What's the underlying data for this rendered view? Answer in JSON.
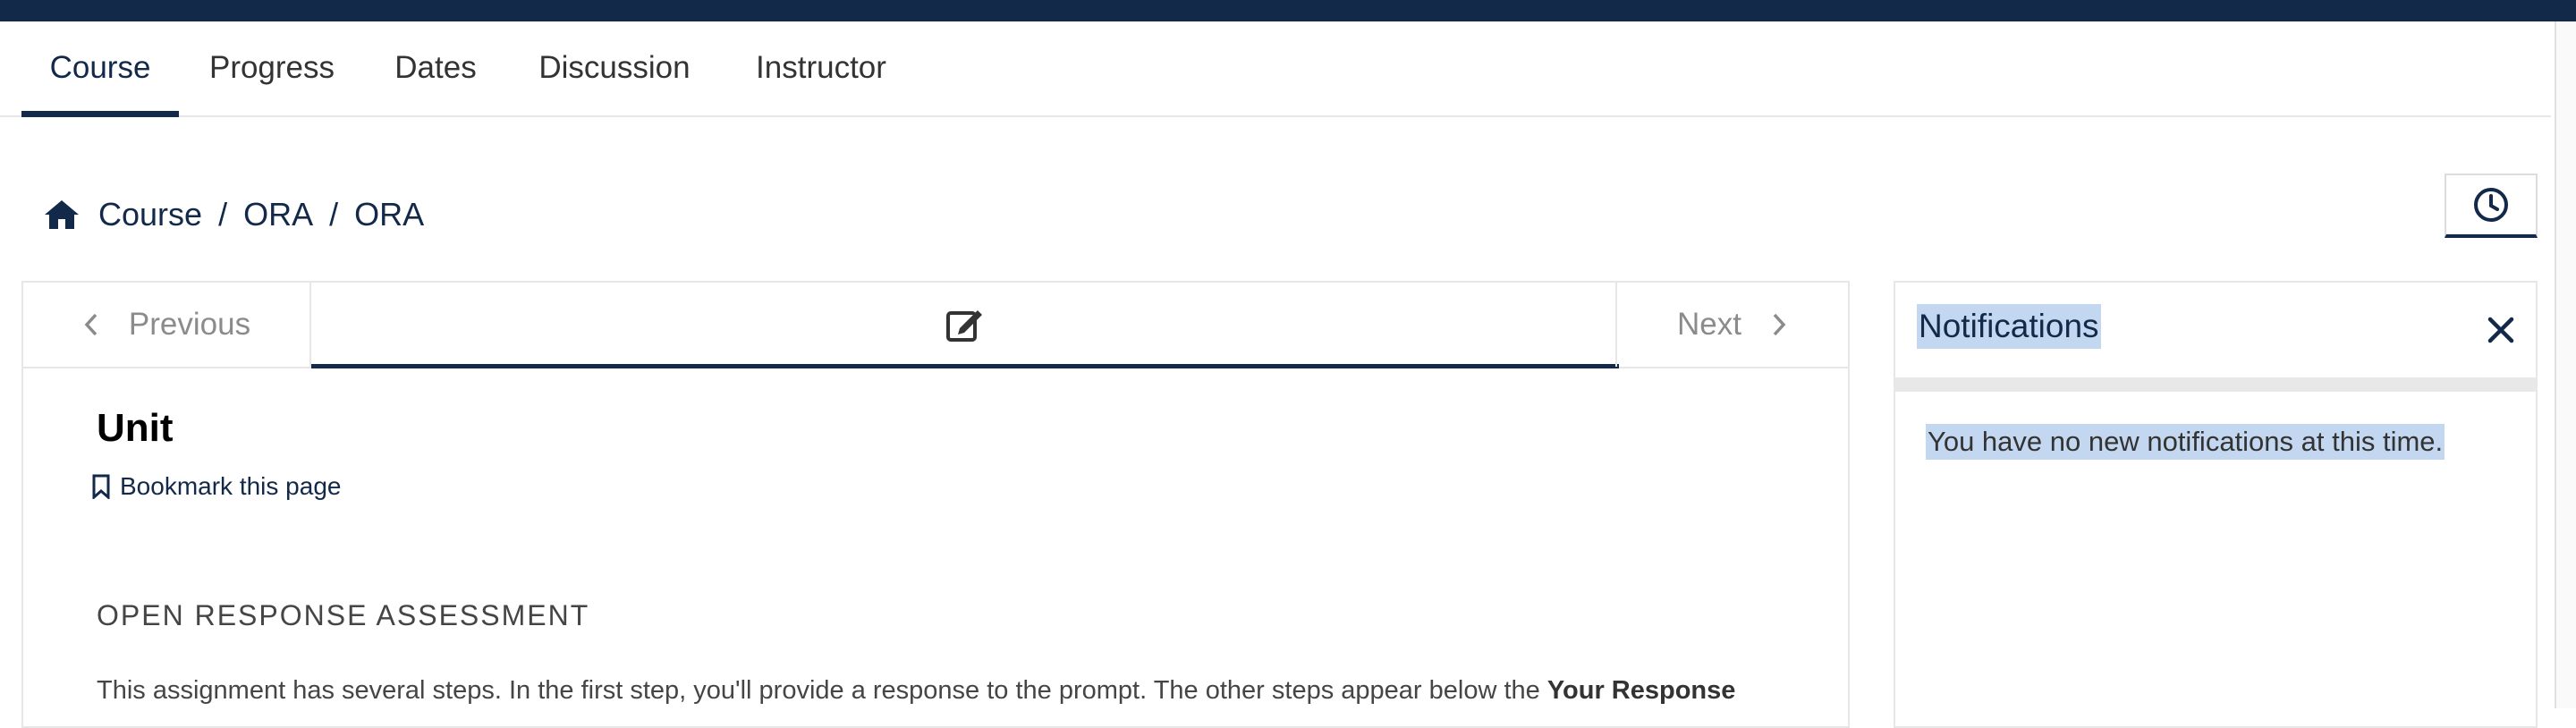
{
  "tabs": [
    {
      "label": "Course",
      "active": true
    },
    {
      "label": "Progress",
      "active": false
    },
    {
      "label": "Dates",
      "active": false
    },
    {
      "label": "Discussion",
      "active": false
    },
    {
      "label": "Instructor",
      "active": false
    }
  ],
  "breadcrumb": {
    "icon": "home-icon",
    "items": [
      "Course",
      "ORA",
      "ORA"
    ],
    "separator": "/"
  },
  "sequence_nav": {
    "previous_label": "Previous",
    "next_label": "Next",
    "unit_icon": "edit-icon"
  },
  "unit": {
    "title": "Unit",
    "bookmark_label": "Bookmark this page",
    "ora_heading": "OPEN RESPONSE ASSESSMENT",
    "ora_text": "This assignment has several steps. In the first step, you'll provide a response to the prompt. The other steps appear below the ",
    "ora_text_bold": "Your Response"
  },
  "notifications": {
    "title": "Notifications",
    "message": "You have no new notifications at this time."
  },
  "colors": {
    "brand": "#12294a",
    "selection": "#c3d8f0"
  }
}
